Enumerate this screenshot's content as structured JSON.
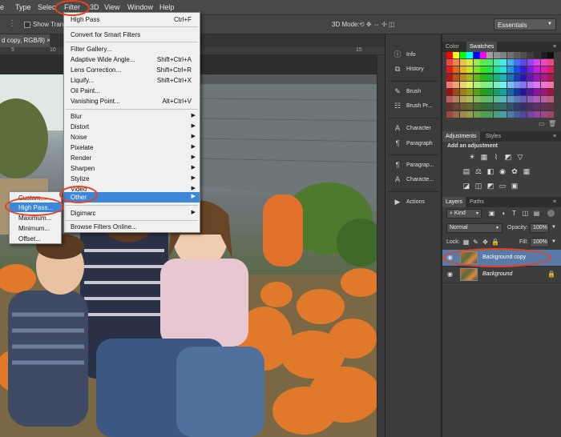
{
  "menubar": {
    "items": [
      "e",
      "Type",
      "Selec",
      "Filter",
      "3D",
      "View",
      "Window",
      "Help"
    ]
  },
  "options": {
    "show_transform": "Show Tran",
    "mode_3d": "3D Mode:",
    "workspace": "Essentials"
  },
  "document": {
    "tab_title": "d copy, RGB/8) ×",
    "ruler_numbers": [
      "5",
      "10",
      "15"
    ]
  },
  "filter_menu": {
    "items": [
      {
        "label": "High Pass",
        "shortcut": "Ctrl+F"
      },
      {
        "label": "Convert for Smart Filters"
      },
      {
        "label": "Filter Gallery..."
      },
      {
        "label": "Adaptive Wide Angle...",
        "shortcut": "Shift+Ctrl+A"
      },
      {
        "label": "Lens Correction...",
        "shortcut": "Shift+Ctrl+R"
      },
      {
        "label": "Liquify...",
        "shortcut": "Shift+Ctrl+X"
      },
      {
        "label": "Oil Paint..."
      },
      {
        "label": "Vanishing Point...",
        "shortcut": "Alt+Ctrl+V"
      },
      {
        "label": "Blur"
      },
      {
        "label": "Distort"
      },
      {
        "label": "Noise"
      },
      {
        "label": "Pixelate"
      },
      {
        "label": "Render"
      },
      {
        "label": "Sharpen"
      },
      {
        "label": "Stylize"
      },
      {
        "label": "Video"
      },
      {
        "label": "Other"
      },
      {
        "label": "Digimarc"
      },
      {
        "label": "Browse Filters Online..."
      }
    ]
  },
  "other_submenu": {
    "items": [
      "Custom...",
      "High Pass...",
      "Maximum...",
      "Minimum...",
      "Offset..."
    ]
  },
  "dock": {
    "buttons": [
      "Info",
      "History",
      "Brush",
      "Brush Pr...",
      "Character",
      "Paragraph",
      "Paragrap...",
      "Characte...",
      "Actions"
    ]
  },
  "panels": {
    "color_tab": "Color",
    "swatches_tab": "Swatches",
    "adjustments_tab": "Adjustments",
    "styles_tab": "Styles",
    "add_adjustment": "Add an adjustment",
    "layers_tab": "Layers",
    "paths_tab": "Paths",
    "kind_filter": "Kind",
    "blend_mode": "Normal",
    "opacity_label": "Opacity:",
    "opacity_value": "100%",
    "lock_label": "Lock:",
    "fill_label": "Fill:",
    "fill_value": "100%",
    "layers": [
      {
        "name": "Background copy"
      },
      {
        "name": "Background"
      }
    ]
  },
  "colors": {
    "callout": "#e8411c",
    "menu_highlight": "#3c87d9",
    "selected_layer": "#5a7aa8"
  }
}
